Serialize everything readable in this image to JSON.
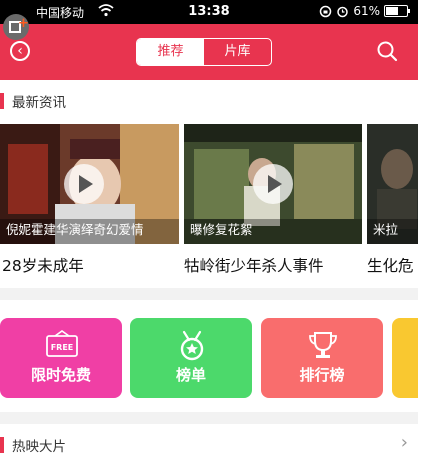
{
  "status_bar": {
    "carrier": "中国移动",
    "time": "13:38",
    "battery": "61%",
    "battery_level": 0.61
  },
  "header": {
    "tabs": [
      {
        "label": "推荐",
        "active": true
      },
      {
        "label": "片库",
        "active": false
      }
    ],
    "accent_color": "#e8344f"
  },
  "news_section": {
    "title": "最新资讯",
    "items": [
      {
        "overlay": "倪妮霍建华演绎奇幻爱情",
        "caption": "28岁未成年"
      },
      {
        "overlay": "曝修复花絮",
        "caption": "牯岭街少年杀人事件"
      },
      {
        "overlay": "米拉",
        "caption": "生化危"
      }
    ]
  },
  "categories": [
    {
      "label": "限时免费",
      "badge": "FREE",
      "icon": "free-ticket-icon",
      "color": "#f03fa5"
    },
    {
      "label": "榜单",
      "icon": "medal-icon",
      "color": "#4cd96b"
    },
    {
      "label": "排行榜",
      "icon": "trophy-icon",
      "color": "#f96d6d"
    },
    {
      "label": "",
      "icon": "",
      "color": "#f9c830"
    }
  ],
  "hot_section": {
    "title": "热映大片"
  }
}
